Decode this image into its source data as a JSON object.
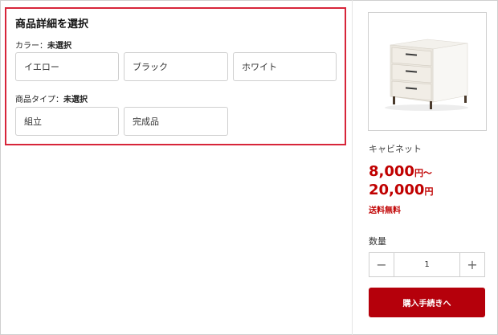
{
  "selection": {
    "title": "商品詳細を選択",
    "color_group": {
      "label": "カラー：",
      "status": "未選択",
      "options": [
        "イエロー",
        "ブラック",
        "ホワイト"
      ]
    },
    "type_group": {
      "label": "商品タイプ：",
      "status": "未選択",
      "options": [
        "組立",
        "完成品"
      ]
    }
  },
  "product": {
    "image_icon": "cabinet-image",
    "name": "キャビネット",
    "price_min": "8,000",
    "price_min_suffix": "円～",
    "price_max": "20,000",
    "price_max_suffix": "円",
    "shipping": "送料無料",
    "quantity_label": "数量",
    "quantity": "1",
    "minus_symbol": "−",
    "plus_symbol": "+",
    "proceed_label": "購入手続きへ",
    "accent_color": "#b5000b",
    "price_color": "#c00000",
    "highlight_border_color": "#d7253a"
  }
}
